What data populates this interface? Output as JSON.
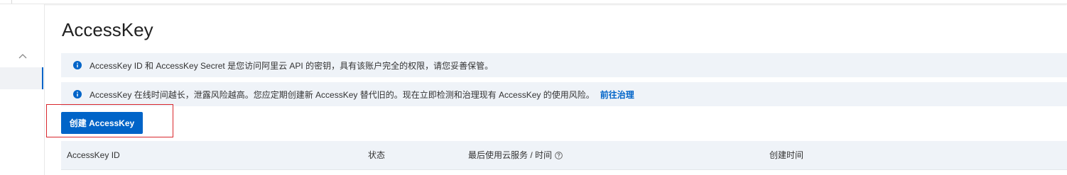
{
  "page": {
    "title": "AccessKey"
  },
  "alerts": [
    {
      "text": "AccessKey ID 和 AccessKey Secret 是您访问阿里云 API 的密钥，具有该账户完全的权限，请您妥善保管。"
    },
    {
      "text": "AccessKey 在线时间越长，泄露风险越高。您应定期创建新 AccessKey 替代旧的。现在立即检测和治理现有 AccessKey 的使用风险。",
      "link": "前往治理"
    }
  ],
  "toolbar": {
    "create_label": "创建 AccessKey"
  },
  "table": {
    "columns": [
      "AccessKey ID",
      "状态",
      "最后使用云服务 / 时间",
      "创建时间"
    ]
  },
  "colors": {
    "primary": "#0064c8",
    "highlight": "#d9262c",
    "alert_bg": "#eff3f8"
  }
}
